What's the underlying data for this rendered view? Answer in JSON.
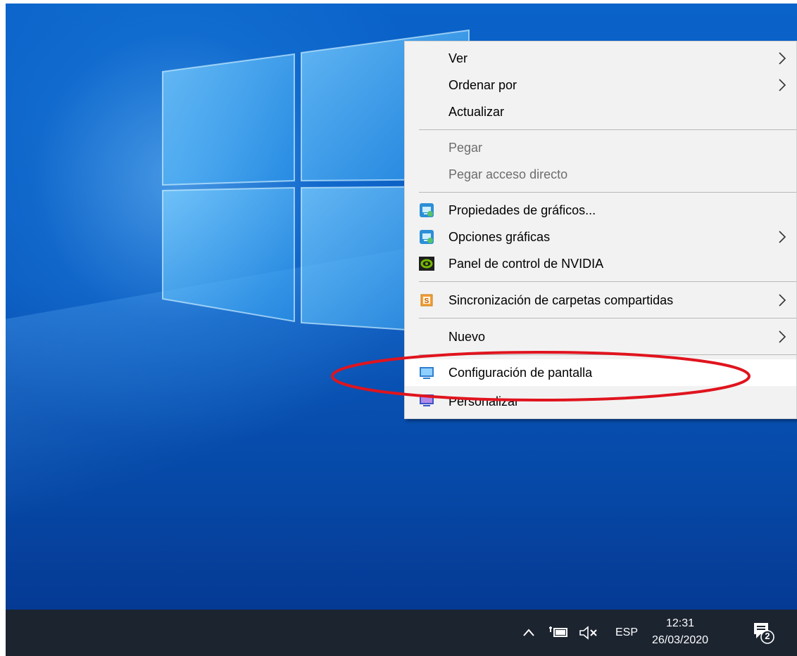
{
  "context_menu": {
    "items": [
      {
        "label": "Ver"
      },
      {
        "label": "Ordenar por"
      },
      {
        "label": "Actualizar"
      },
      {
        "label": "Pegar"
      },
      {
        "label": "Pegar acceso directo"
      },
      {
        "label": "Propiedades de gráficos..."
      },
      {
        "label": "Opciones gráficas"
      },
      {
        "label": "Panel de control de NVIDIA"
      },
      {
        "label": "Sincronización de carpetas compartidas"
      },
      {
        "label": "Nuevo"
      },
      {
        "label": "Configuración de pantalla"
      },
      {
        "label": "Personalizar"
      }
    ]
  },
  "taskbar": {
    "language": "ESP",
    "time": "12:31",
    "date": "26/03/2020",
    "notification_count": "2"
  },
  "colors": {
    "desktop_blue": "#0a5ac0",
    "taskbar": "#1c2430",
    "menu_background": "#f2f2f2",
    "highlight_ellipse": "#e0141e"
  }
}
